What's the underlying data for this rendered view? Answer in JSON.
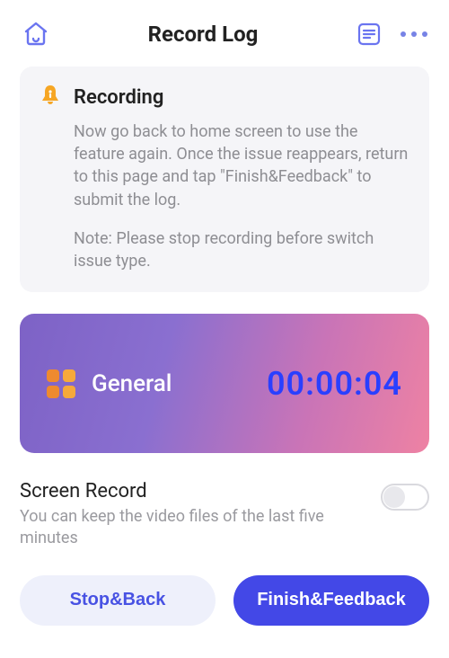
{
  "header": {
    "title": "Record Log"
  },
  "info": {
    "heading": "Recording",
    "body": "Now go back to home screen to use the feature again. Once the issue reappears, return to this page and tap \"Finish&Feedback\" to submit the log.",
    "note": "Note: Please stop recording before switch issue type."
  },
  "recording": {
    "category": "General",
    "timer": "00:00:04"
  },
  "screen_record": {
    "title": "Screen Record",
    "description": "You can keep the video files of the last five minutes",
    "enabled": false
  },
  "buttons": {
    "stop_back": "Stop&Back",
    "finish_feedback": "Finish&Feedback"
  },
  "icons": {
    "home": "home-icon",
    "list": "list-icon",
    "more": "more-icon",
    "bell": "bell-alert-icon",
    "grid": "grid-icon"
  },
  "colors": {
    "accent": "#4348e7",
    "timer": "#2a3fff",
    "grid_a": "#ee8a2f",
    "grid_b": "#f6a93b"
  }
}
